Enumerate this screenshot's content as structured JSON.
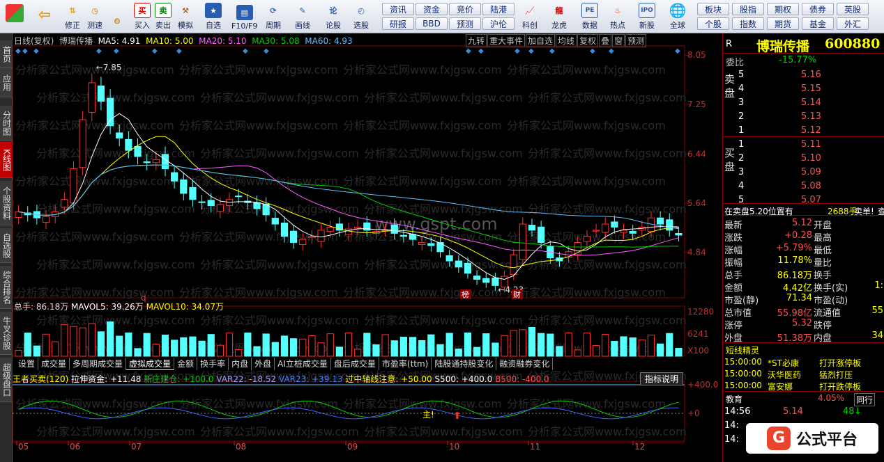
{
  "toolbar": {
    "buttons": [
      "",
      "",
      "修正",
      "测速",
      "买入",
      "卖出",
      "模拟",
      "自选",
      "F10/F9",
      "周期",
      "画线",
      "论股",
      "选股"
    ],
    "grid": [
      [
        "资讯",
        "资金",
        "竞价",
        "陆港"
      ],
      [
        "研报",
        "BBD",
        "预测",
        "沪伦"
      ]
    ],
    "icons": [
      "科创",
      "龙虎",
      "数据",
      "热点",
      "新股",
      "全球"
    ],
    "grid2": [
      [
        "板块",
        "股指",
        "期权",
        "债券",
        "英股"
      ],
      [
        "个股",
        "指数",
        "期货",
        "基金",
        "外汇"
      ]
    ]
  },
  "sidebar": [
    "首页",
    "应用",
    "分时图",
    "K线图",
    "个股资料",
    "自选股",
    "综合排名",
    "牛叉诊股",
    "超级盘口"
  ],
  "chart": {
    "header": [
      "日线(复权)",
      "博瑞传播",
      "MA5: 4.91",
      "MA10: 5.00",
      "MA20: 5.10",
      "MA30: 5.08",
      "MA60: 4.93"
    ],
    "header_right": [
      "九转",
      "重大事件",
      "加自选",
      "均线",
      "复权",
      "叠",
      "窗",
      "预测"
    ],
    "price_axis": [
      "8.05",
      "7.25",
      "6.44",
      "5.64",
      "4.84"
    ],
    "high_label": "7.85",
    "low_label": "4.23",
    "marks": [
      "q",
      "榜",
      "财"
    ],
    "watermark": "分析家公式网www.fxjgsw.com",
    "watermark2": "www.gspt.com",
    "vol_header": [
      "总手: 86.18万",
      "MAVOL5: 39.26万",
      "MAVOL10: 34.07万"
    ],
    "vol_axis": [
      "12280",
      "6241",
      "X100"
    ],
    "tabs": [
      "设置",
      "成交量",
      "多周期成交量",
      "虚拟成交量",
      "金额",
      "换手率",
      "内盘",
      "外盘",
      "AI立桩成交量",
      "盘后成交量",
      "市盈率(ttm)",
      "陆股通持股变化",
      "融资融券变化"
    ],
    "ind_header": [
      "王者买卖(120)",
      "拉伸资金: +11.48",
      "新庄建仓: +100.0",
      "VAR22: -18.52",
      "VAR23: +39.13",
      "过中轴线注意: +50.00",
      "S500: +400.0",
      "B500: -400.0"
    ],
    "ind_btn": "指标说明",
    "ind_axis": [
      "+400.0",
      "+0"
    ],
    "ind_mark": "主!",
    "months": [
      "05",
      "06",
      "07",
      "08",
      "09",
      "10",
      "11",
      "12"
    ]
  },
  "chart_data": {
    "type": "candlestick",
    "title": "博瑞传播 600880 日线(复权)",
    "price_ticks": [
      8.05,
      7.25,
      6.44,
      5.64,
      4.84
    ],
    "high": 7.85,
    "low": 4.23,
    "ma": {
      "MA5": 4.91,
      "MA10": 5.0,
      "MA20": 5.1,
      "MA30": 5.08,
      "MA60": 4.93
    },
    "closes": [
      5.5,
      5.45,
      5.4,
      5.42,
      5.5,
      5.7,
      6.2,
      7.0,
      7.6,
      7.3,
      6.9,
      6.7,
      6.5,
      6.4,
      6.3,
      6.35,
      6.2,
      6.0,
      5.8,
      5.7,
      5.65,
      5.6,
      5.62,
      5.7,
      5.75,
      5.65,
      5.55,
      5.45,
      5.3,
      5.1,
      5.0,
      5.05,
      5.1,
      5.2,
      5.25,
      5.2,
      5.22,
      5.25,
      5.2,
      5.18,
      5.2,
      5.15,
      5.1,
      5.05,
      5.0,
      4.95,
      4.85,
      4.7,
      4.6,
      4.5,
      4.4,
      4.35,
      4.3,
      4.45,
      4.8,
      5.3,
      5.2,
      5.0,
      4.75,
      4.7,
      4.85,
      5.0,
      5.1,
      5.2,
      5.3,
      5.25,
      5.2,
      5.15,
      5.25,
      5.4,
      5.3,
      5.2,
      5.12
    ]
  },
  "right": {
    "title": "博瑞传播",
    "code": "600880",
    "R": "R",
    "weibi_label": "委比",
    "weibi": "-15.77%",
    "sell_label": "卖盘",
    "buy_label": "买盘",
    "sell": [
      [
        "5",
        "5.16"
      ],
      [
        "4",
        "5.15"
      ],
      [
        "3",
        "5.14"
      ],
      [
        "2",
        "5.13"
      ],
      [
        "1",
        "5.12"
      ]
    ],
    "buy": [
      [
        "1",
        "5.11"
      ],
      [
        "2",
        "5.10"
      ],
      [
        "3",
        "5.09"
      ],
      [
        "4",
        "5.08"
      ],
      [
        "5",
        "5.07"
      ]
    ],
    "note": "在卖盘5.20位置有",
    "note_vol": "2688手",
    "note_tail": "卖单!",
    "note_btn": "查",
    "quote": [
      [
        "最新",
        "5.12",
        "开盘",
        ""
      ],
      [
        "涨跌",
        "+0.28",
        "最高",
        ""
      ],
      [
        "涨幅",
        "+5.79%",
        "最低",
        ""
      ],
      [
        "振幅",
        "11.78%",
        "量比",
        ""
      ],
      [
        "总手",
        "86.18万",
        "换手",
        ""
      ],
      [
        "金额",
        "4.42亿",
        "换手(实)",
        "1:"
      ],
      [
        "市盈(静)",
        "71.34",
        "市盈(动)",
        ""
      ],
      [
        "总市值",
        "55.98亿",
        "流通值",
        "55"
      ],
      [
        "涨停",
        "5.32",
        "跌停",
        ""
      ],
      [
        "外盘",
        "51.38万",
        "内盘",
        "34"
      ]
    ],
    "fast_title": "短线精灵",
    "fast": [
      [
        "15:00:00",
        "*ST必康",
        "打开涨停板"
      ],
      [
        "15:00:00",
        "沃华医药",
        "猛烈打压"
      ],
      [
        "15:00:00",
        "富安娜",
        "打开跌停板"
      ]
    ],
    "sector": "教育",
    "sector_pct": "4.05%",
    "sector_btn": "同行",
    "ticks": [
      [
        "14:56",
        "5.14",
        "48"
      ],
      [
        "14:",
        ""
      ],
      [
        "14:",
        ""
      ]
    ],
    "logo": "公式平台"
  }
}
